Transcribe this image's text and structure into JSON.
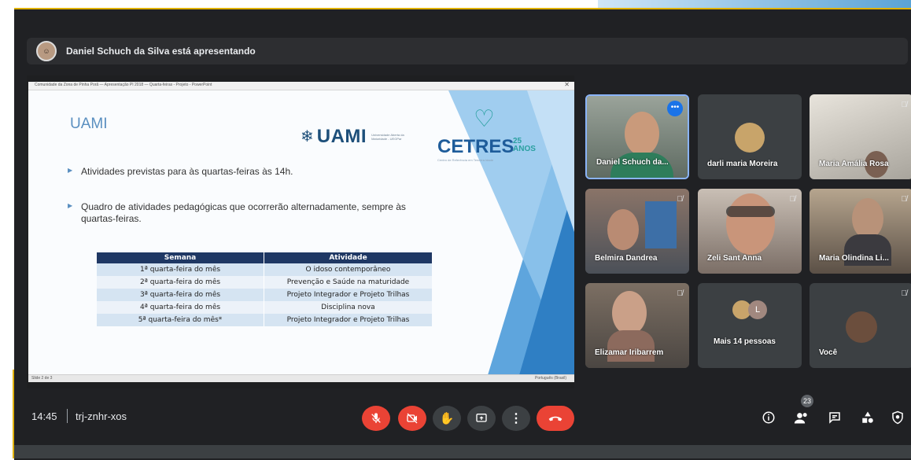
{
  "presenter": {
    "text": "Daniel Schuch da Silva está apresentando"
  },
  "slide": {
    "window_title": "Comunidade da Zona de Pinha Porã — Apresentação PI 2018 — Quarta-feiras - Projeto - PowerPoint",
    "status_left": "Slide 2 de 3",
    "status_right": "Português (Brasil)",
    "title": "UAMI",
    "uami_logo": "UAMI",
    "uami_sub": "Universidade Aberta da Maturidade - UEGPar",
    "cetres_logo": "CETRES",
    "cetres_num": "25 ANOS",
    "cetres_sub": "Centro de Referência em Terceira Idade",
    "bullets": [
      "Atividades previstas para às quartas-feiras às 14h.",
      "Quadro de atividades pedagógicas que ocorrerão alternadamente, sempre às quartas-feiras."
    ],
    "table": {
      "headers": [
        "Semana",
        "Atividade"
      ],
      "rows": [
        [
          "1ª quarta-feira do mês",
          "O idoso contemporâneo"
        ],
        [
          "2ª quarta-feira do mês",
          "Prevenção e Saúde na maturidade"
        ],
        [
          "3ª quarta-feira do mês",
          "Projeto Integrador e Projeto Trilhas"
        ],
        [
          "4ª quarta-feira do mês",
          "Disciplina nova"
        ],
        [
          "5ª quarta-feira do mês*",
          "Projeto Integrador e Projeto Trilhas"
        ]
      ]
    }
  },
  "participants": [
    {
      "name": "Daniel Schuch da...",
      "muted": false,
      "active": true
    },
    {
      "name": "darli maria Moreira",
      "muted": false
    },
    {
      "name": "Maria Amália Rosa",
      "muted": true
    },
    {
      "name": "Belmira Dandrea",
      "muted": true
    },
    {
      "name": "Zeli Sant Anna",
      "muted": true
    },
    {
      "name": "Maria Olindina Li...",
      "muted": true
    },
    {
      "name": "Elizamar Iribarrem",
      "muted": true
    },
    {
      "name": "Mais 14 pessoas",
      "avatar_letter": "L"
    },
    {
      "name": "Você",
      "muted": true
    }
  ],
  "meeting": {
    "time": "14:45",
    "code": "trj-znhr-xos",
    "people_count": "23",
    "separator": "|"
  },
  "icons": {
    "mic": "mic-off-icon",
    "camera": "camera-off-icon",
    "hand": "raise-hand-icon",
    "present": "present-screen-icon",
    "more": "more-options-icon",
    "end": "end-call-icon",
    "info": "info-icon",
    "people": "people-icon",
    "chat": "chat-icon",
    "activities": "activities-icon",
    "safety": "host-controls-icon"
  },
  "colors": {
    "end_call": "#ea4335",
    "background": "#202124",
    "tile": "#3c4043",
    "table_header": "#1f3864",
    "active_border": "#8ab4f8"
  }
}
